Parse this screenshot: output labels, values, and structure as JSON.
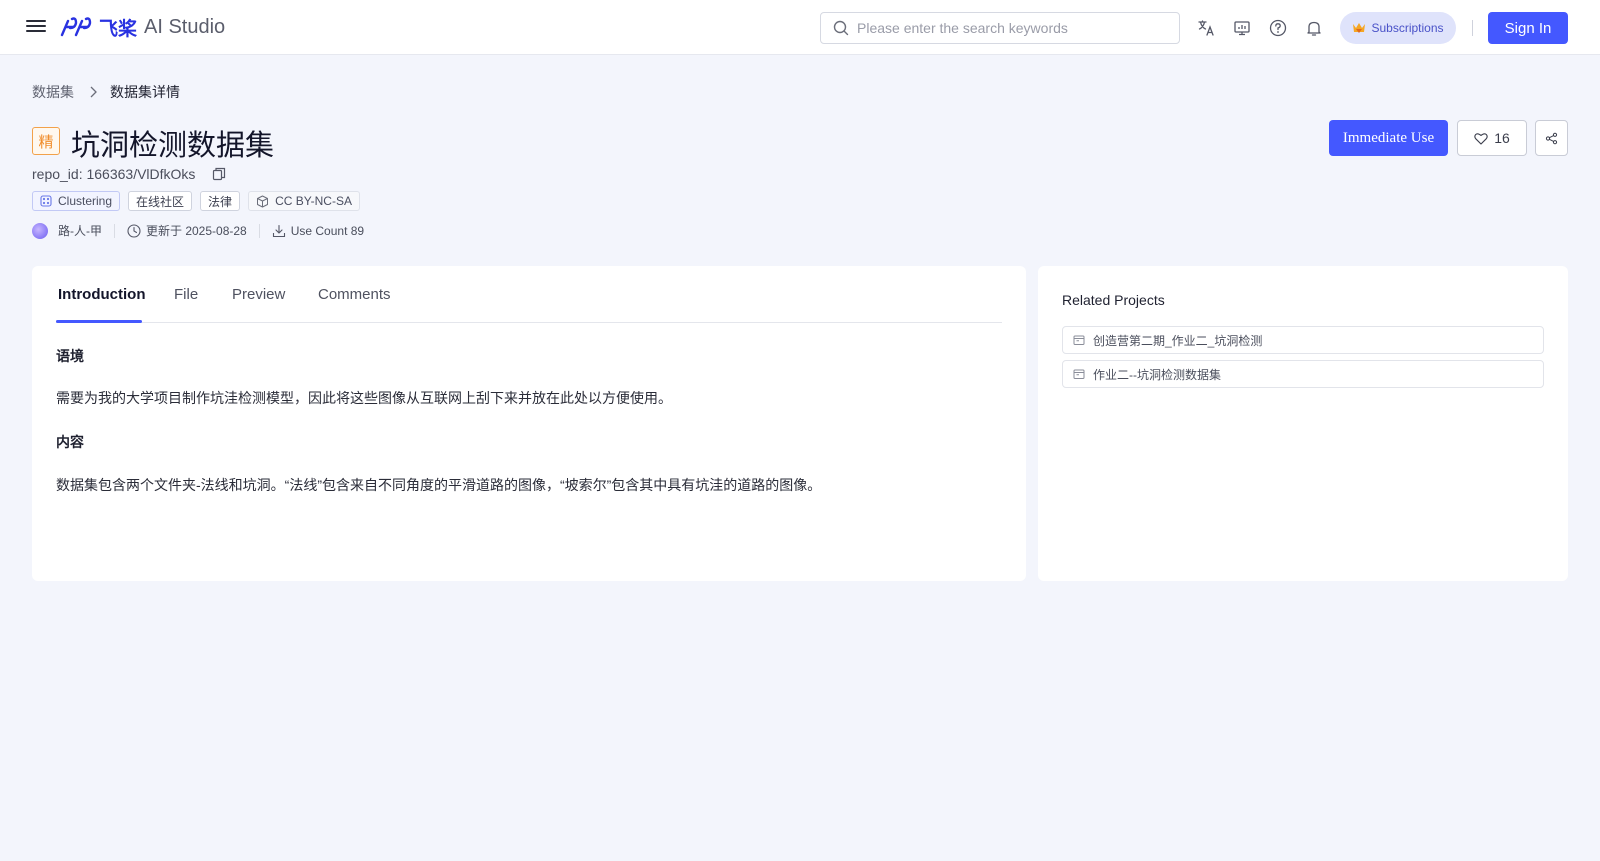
{
  "header": {
    "logo_mark": "つづつ",
    "logo_cn": "飞桨",
    "logo_text": "AI Studio",
    "search_placeholder": "Please enter the search keywords",
    "icons": [
      "translate-icon",
      "monitor-icon",
      "help-icon",
      "bell-icon"
    ],
    "subscriptions_label": "Subscriptions",
    "signin_label": "Sign In"
  },
  "breadcrumb": {
    "parent": "数据集",
    "current": "数据集详情"
  },
  "dataset": {
    "badge": "精",
    "title": "坑洞检测数据集",
    "repo_id": "repo_id: 166363/VlDfkOks",
    "tags": [
      "Clustering",
      "在线社区",
      "法律",
      "CC BY-NC-SA"
    ],
    "author": "路-人-甲",
    "updated": "更新于 2025-08-28",
    "use_count": "Use Count 89"
  },
  "actions": {
    "use_label": "Immediate Use",
    "like_count": "16"
  },
  "tabs": [
    "Introduction",
    "File",
    "Preview",
    "Comments"
  ],
  "content": {
    "heading_1": "语境",
    "para_1": "需要为我的大学项目制作坑洼检测模型，因此将这些图像从互联网上刮下来并放在此处以方便使用。",
    "heading_2": "内容",
    "para_2": "数据集包含两个文件夹-法线和坑洞。“法线”包含来自不同角度的平滑道路的图像，“坡索尔”包含其中具有坑洼的道路的图像。"
  },
  "related": {
    "title": "Related Projects",
    "items": [
      "创造营第二期_作业二_坑洞检测",
      "作业二--坑洞检测数据集"
    ]
  },
  "colors": {
    "accent": "#4458ff",
    "brand": "#2932e1",
    "featured_badge": "#f08c2a",
    "background": "#f3f5fc"
  }
}
